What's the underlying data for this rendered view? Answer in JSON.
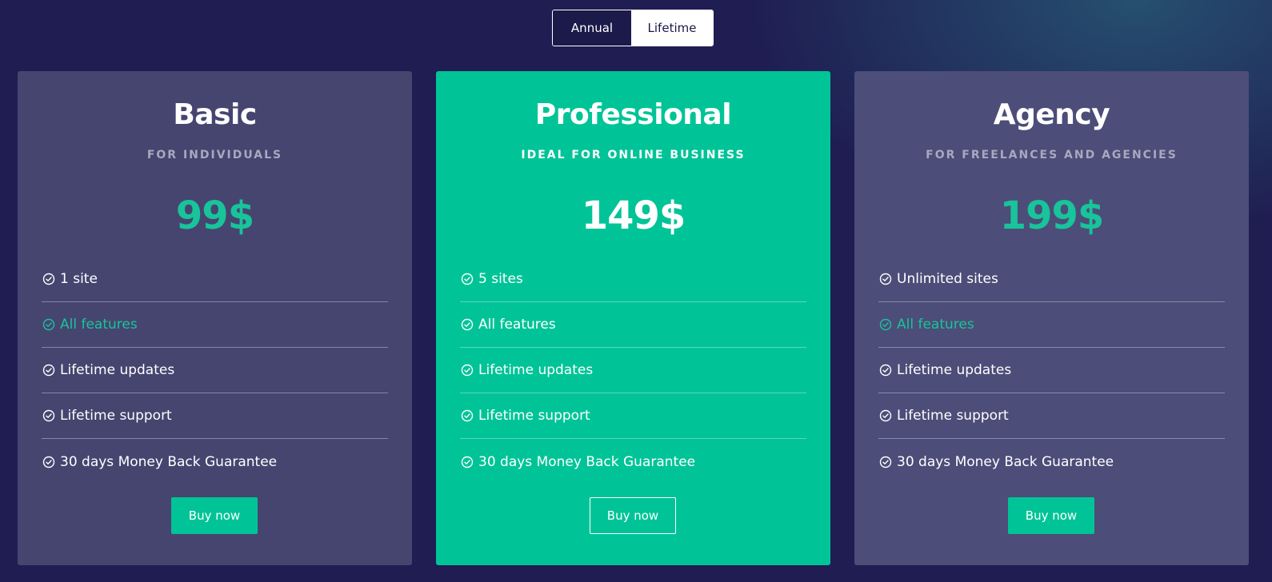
{
  "toggle": {
    "options": [
      "Annual",
      "Lifetime"
    ],
    "selected": "Annual"
  },
  "plans": [
    {
      "name": "Basic",
      "subtitle": "FOR INDIVIDUALS",
      "price": "99$",
      "features": [
        {
          "label": "1 site",
          "highlight": false
        },
        {
          "label": "All features",
          "highlight": true
        },
        {
          "label": "Lifetime updates",
          "highlight": false
        },
        {
          "label": "Lifetime support",
          "highlight": false
        },
        {
          "label": "30 days Money Back Guarantee",
          "highlight": false
        }
      ],
      "button": "Buy now"
    },
    {
      "name": "Professional",
      "subtitle": "IDEAL FOR ONLINE BUSINESS",
      "price": "149$",
      "features": [
        {
          "label": "5 sites",
          "highlight": false
        },
        {
          "label": "All features",
          "highlight": false
        },
        {
          "label": "Lifetime updates",
          "highlight": false
        },
        {
          "label": "Lifetime support",
          "highlight": false
        },
        {
          "label": "30 days Money Back Guarantee",
          "highlight": false
        }
      ],
      "button": "Buy now",
      "featured": true
    },
    {
      "name": "Agency",
      "subtitle": "FOR FREELANCES AND AGENCIES",
      "price": "199$",
      "features": [
        {
          "label": "Unlimited sites",
          "highlight": false
        },
        {
          "label": "All features",
          "highlight": true
        },
        {
          "label": "Lifetime updates",
          "highlight": false
        },
        {
          "label": "Lifetime support",
          "highlight": false
        },
        {
          "label": "30 days Money Back Guarantee",
          "highlight": false
        }
      ],
      "button": "Buy now"
    }
  ],
  "colors": {
    "background": "#1f1d52",
    "accent": "#00c497",
    "card": "#464570",
    "featured_card": "#00c497"
  },
  "icons": {
    "feature": "check-circle-icon"
  }
}
